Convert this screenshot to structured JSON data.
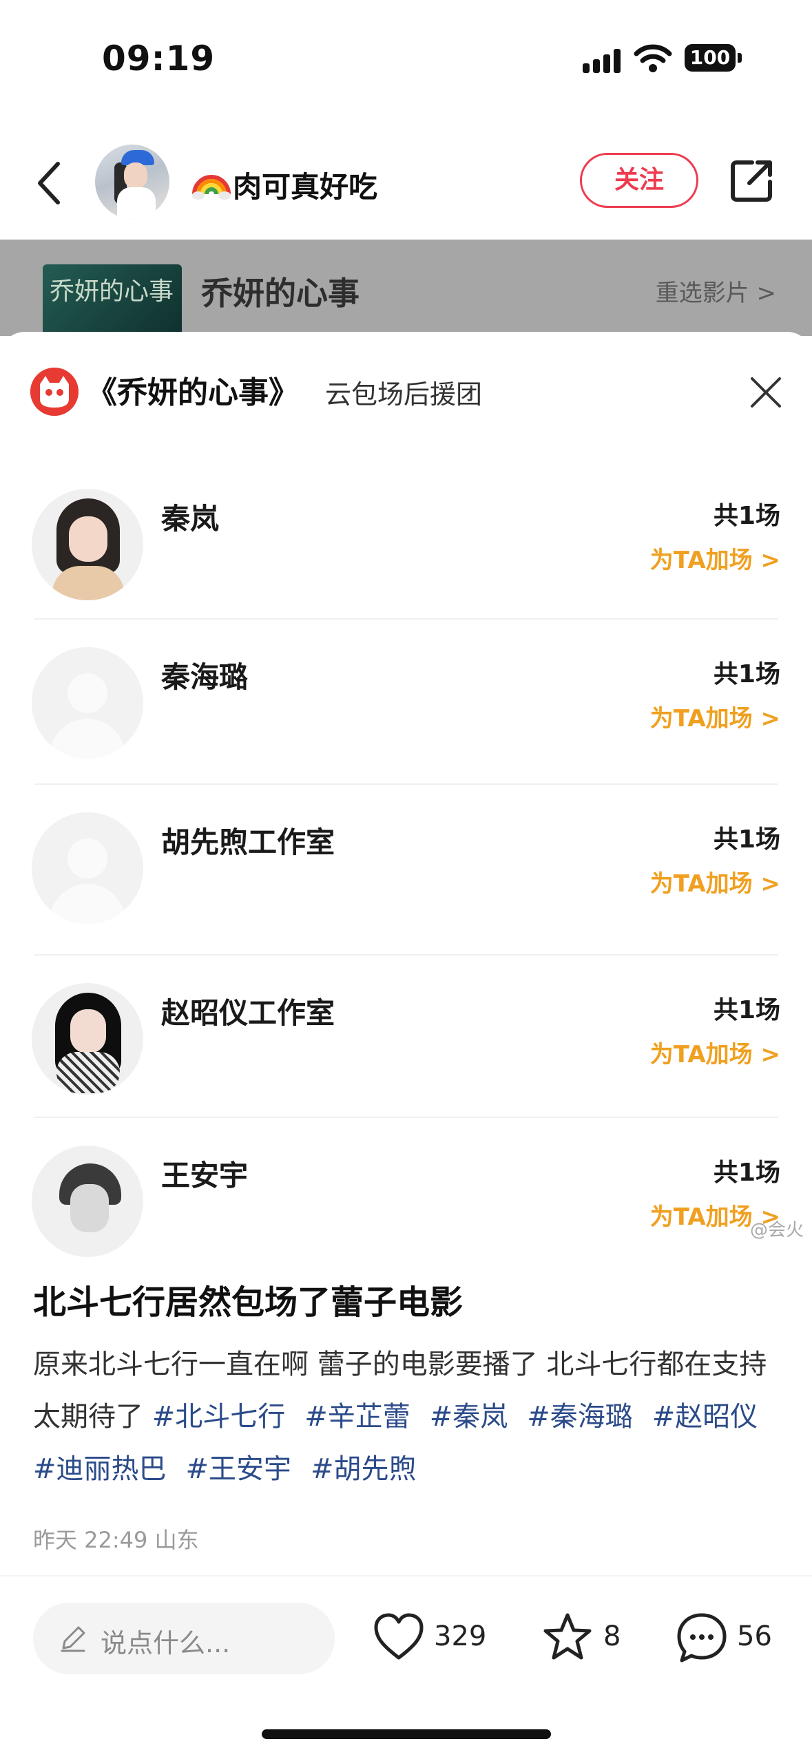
{
  "status_bar": {
    "time": "09:19",
    "battery": "100"
  },
  "header": {
    "nickname": "肉可真好吃",
    "follow_label": "关注"
  },
  "movie": {
    "poster_text": "乔妍的心事",
    "title": "乔妍的心事",
    "reselect_label": "重选影片 >"
  },
  "panel": {
    "title": "《乔妍的心事》",
    "subtitle": "云包场后援团",
    "supporters": [
      {
        "name": "秦岚",
        "count": "共1场",
        "action": "为TA加场 >"
      },
      {
        "name": "秦海璐",
        "count": "共1场",
        "action": "为TA加场 >"
      },
      {
        "name": "胡先煦工作室",
        "count": "共1场",
        "action": "为TA加场 >"
      },
      {
        "name": "赵昭仪工作室",
        "count": "共1场",
        "action": "为TA加场 >"
      },
      {
        "name": "王安宇",
        "count": "共1场",
        "action": "为TA加场 >"
      }
    ],
    "watermark": "@会火"
  },
  "post": {
    "title": "北斗七行居然包场了蕾子电影",
    "body": "原来北斗七行一直在啊 蕾子的电影要播了 北斗七行都在支持 太期待了",
    "tags": [
      "#北斗七行",
      "#辛芷蕾",
      "#秦岚",
      "#秦海璐",
      "#赵昭仪",
      "#迪丽热巴",
      "#王安宇",
      "#胡先煦"
    ],
    "meta": "昨天 22:49 山东"
  },
  "bottom_bar": {
    "comment_placeholder": "说点什么...",
    "likes": "329",
    "favorites": "8",
    "comments": "56"
  },
  "colors": {
    "accent_red": "#ee3b4f",
    "boost_orange": "#f0a020",
    "tag_blue": "#2b4b8a"
  }
}
